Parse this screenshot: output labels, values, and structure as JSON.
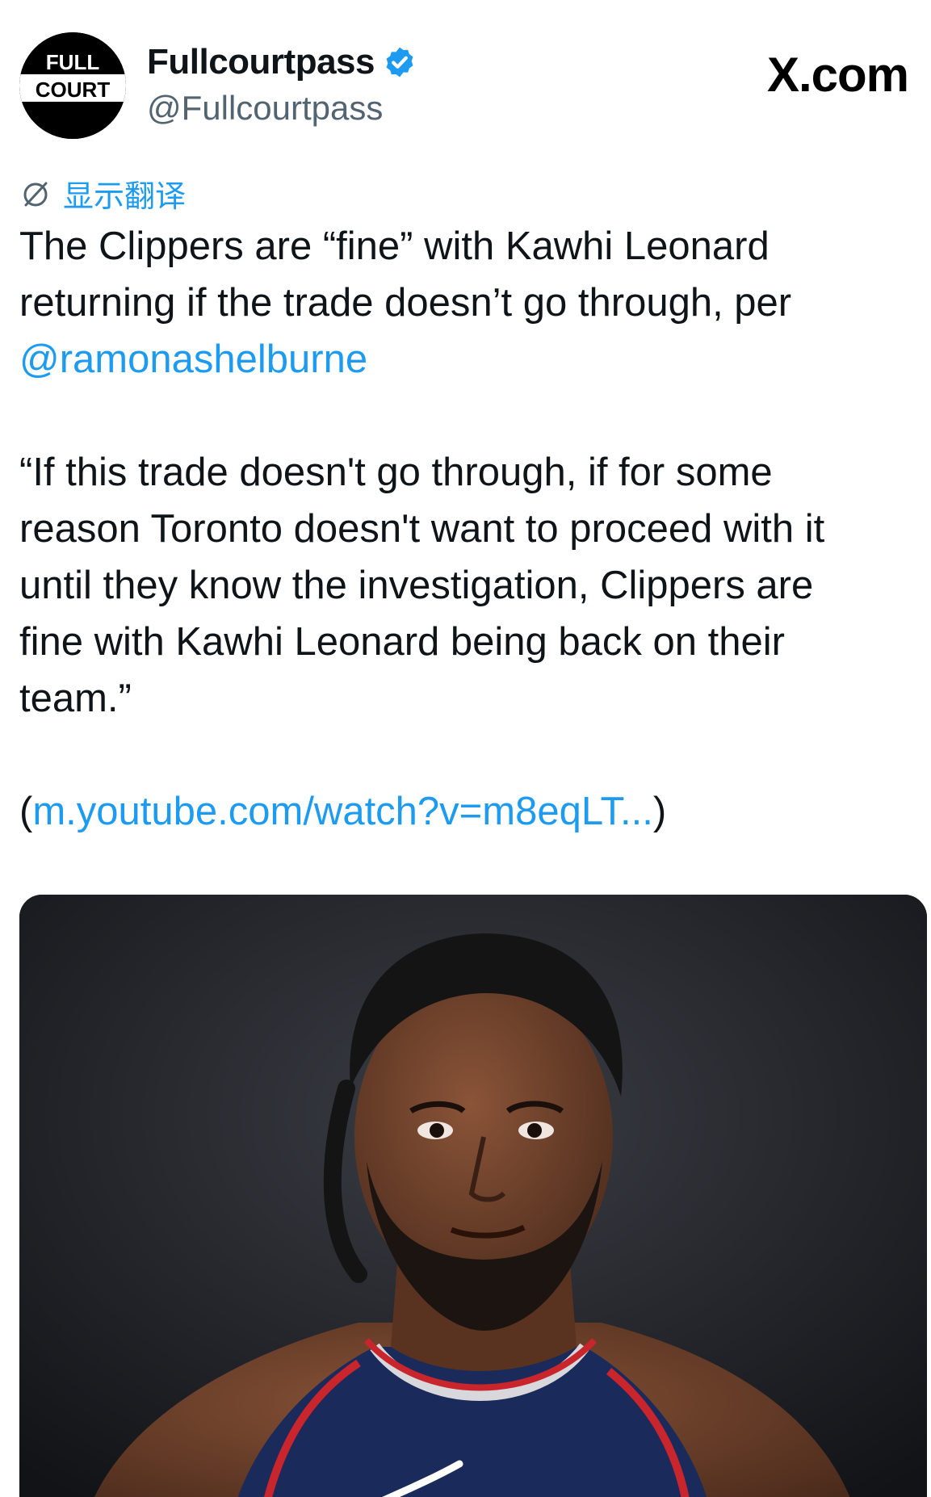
{
  "author": {
    "display_name": "Fullcourtpass",
    "handle": "@Fullcourtpass",
    "verified": true,
    "avatar_text_line1": "FULL",
    "avatar_text_line2": "COURT"
  },
  "brand": "X.com",
  "translate_label": "显示翻译",
  "tweet": {
    "line1": "The Clippers are “fine” with Kawhi Leonard",
    "line2": "returning if the trade doesn’t go through, per",
    "mention": "@ramonashelburne",
    "quote1": "“If this trade doesn't go through, if for some",
    "quote2": "reason Toronto doesn't want to proceed with it",
    "quote3": "until they know the investigation, Clippers are",
    "quote4": "fine with Kawhi Leonard being back on their",
    "quote5": "team.”",
    "link_open": "(",
    "link_text": "m.youtube.com/watch?v=m8eqLT...",
    "link_close": ")"
  },
  "colors": {
    "link": "#1d9bf0",
    "handle": "#536471",
    "verified": "#1d9bf0"
  },
  "icons": [
    "verified-badge-icon",
    "translate-icon"
  ]
}
